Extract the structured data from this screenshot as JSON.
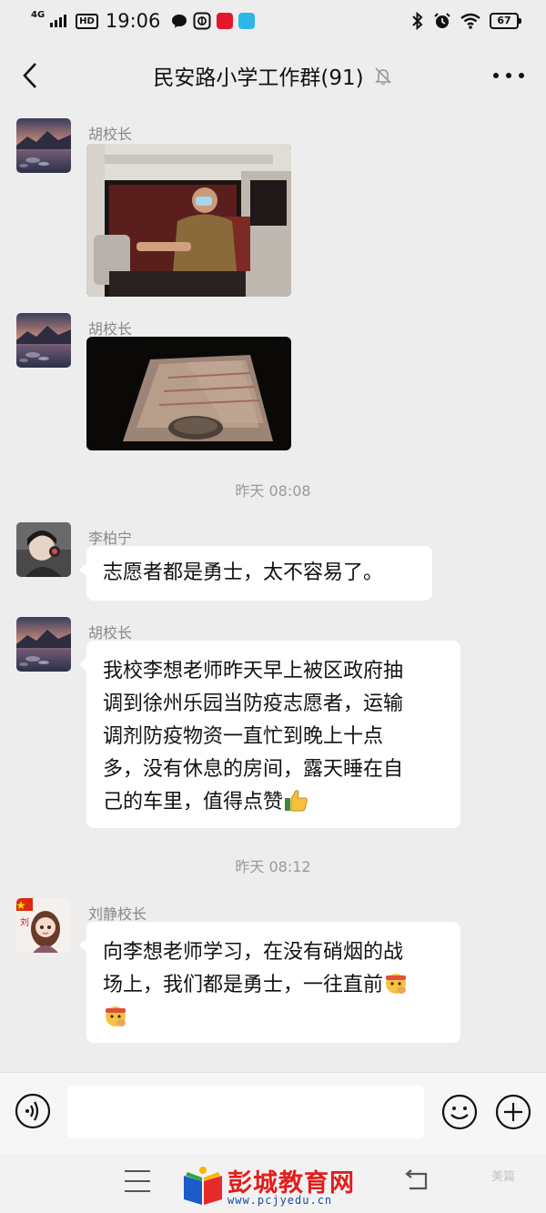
{
  "status_bar": {
    "network": "4G",
    "hd": "HD",
    "time": "19:06",
    "battery": "67",
    "colors": {
      "app1": "#e5172f",
      "app2": "#2db6e8"
    }
  },
  "header": {
    "title": "民安路小学工作群(91)",
    "back_icon": "chevron-left-icon",
    "mute_icon": "bell-muted-icon",
    "more_icon": "more-dots-icon"
  },
  "messages": [
    {
      "sender": "胡校长",
      "type": "image",
      "image_desc": "driver-in-truck-photo"
    },
    {
      "sender": "胡校长",
      "type": "image",
      "image_desc": "truck-bed-night-photo"
    },
    {
      "type": "time",
      "text": "昨天  08:08"
    },
    {
      "sender": "李柏宁",
      "type": "text",
      "text": "志愿者都是勇士，太不容易了。"
    },
    {
      "sender": "胡校长",
      "type": "text",
      "lines": [
        "我校李想老师昨天早上被区政府抽",
        "调到徐州乐园当防疫志愿者，运输",
        "调剂防疫物资一直忙到晚上十点",
        "多，没有休息的房间，露天睡在自",
        "己的车里，值得点赞"
      ]
    },
    {
      "type": "time",
      "text": "昨天  08:12"
    },
    {
      "sender": "刘静校长",
      "type": "text",
      "lines": [
        "向李想老师学习，在没有硝烟的战",
        "场上，我们都是勇士，一往直前"
      ]
    }
  ],
  "input_bar": {
    "voice_icon": "voice-icon",
    "emoji_icon": "smiley-icon",
    "plus_icon": "plus-icon"
  },
  "nav_bar": {
    "logo_text": "彭城教育网",
    "logo_url": "www.pcjyedu.cn",
    "watermark": "美篇"
  }
}
